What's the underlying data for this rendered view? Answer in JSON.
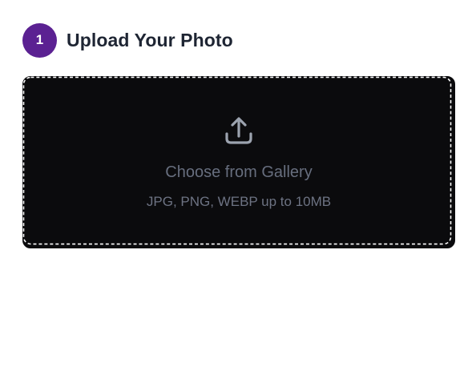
{
  "step": {
    "number": "1",
    "title": "Upload Your Photo"
  },
  "dropzone": {
    "icon": "upload-icon",
    "title": "Choose from Gallery",
    "subtitle": "JPG, PNG, WEBP up to 10MB"
  },
  "colors": {
    "accent": "#5b2192",
    "dropzone_bg": "#0b0b0d",
    "dropzone_text": "#676e7e",
    "heading": "#1e2533"
  }
}
